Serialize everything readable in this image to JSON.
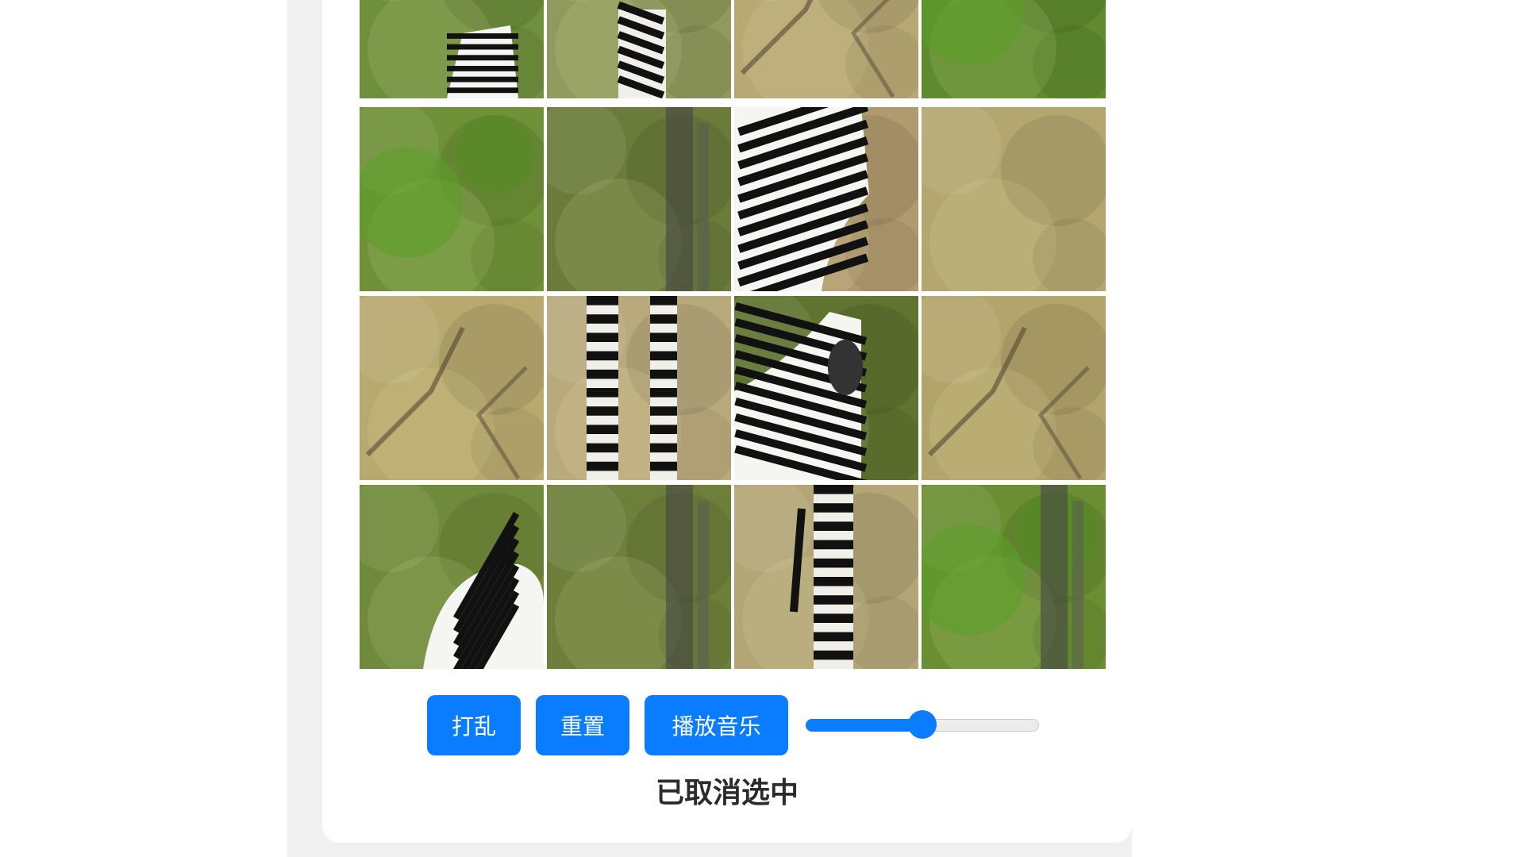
{
  "controls": {
    "shuffle_label": "打乱",
    "reset_label": "重置",
    "play_music_label": "播放音乐",
    "volume": 0.5
  },
  "status_text": "已取消选中",
  "colors": {
    "button": "#0a7cff",
    "page_background": "#f0f0f0",
    "card": "#ffffff"
  },
  "board": {
    "tiles": [
      {
        "kind": "zebra-head-top",
        "bg": "#6e8f3c"
      },
      {
        "kind": "zebra-legs-top",
        "bg": "#8f9a5c"
      },
      {
        "kind": "dry-grass-branches",
        "bg": "#b7a874"
      },
      {
        "kind": "green-bush",
        "bg": "#5f8a2e"
      },
      {
        "kind": "green-bush",
        "bg": "#6f9138"
      },
      {
        "kind": "forest-trunk",
        "bg": "#6b7b3a"
      },
      {
        "kind": "zebra-chest",
        "bg": "#b09a6e"
      },
      {
        "kind": "dry-grass",
        "bg": "#b3a66f"
      },
      {
        "kind": "dry-brush",
        "bg": "#b8a96e"
      },
      {
        "kind": "zebra-legs",
        "bg": "#b9aa7c"
      },
      {
        "kind": "zebra-face",
        "bg": "#60732f"
      },
      {
        "kind": "dry-brush-branches",
        "bg": "#b3a46b"
      },
      {
        "kind": "zebra-back",
        "bg": "#6f8a3a"
      },
      {
        "kind": "forest-trunk",
        "bg": "#6e7f3a"
      },
      {
        "kind": "zebra-leg-tail",
        "bg": "#b3a576"
      },
      {
        "kind": "forest-trunk-green",
        "bg": "#6a8f32"
      }
    ]
  }
}
